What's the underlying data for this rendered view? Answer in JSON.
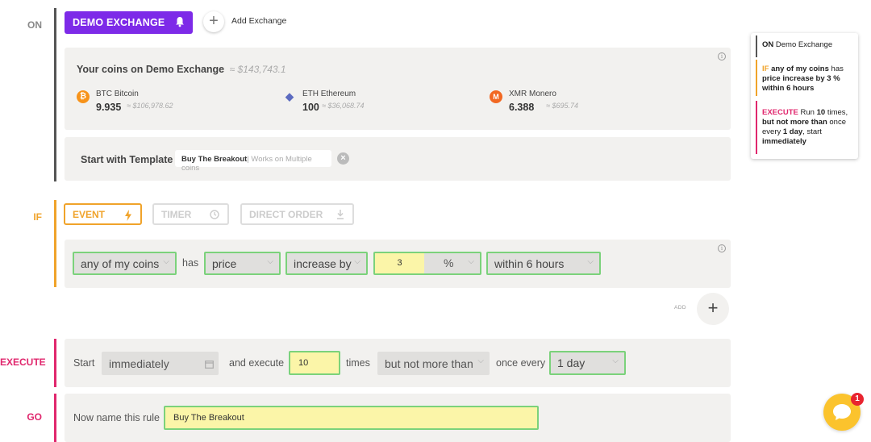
{
  "colors": {
    "on": "#555555",
    "if": "#f0a32a",
    "execute": "#e0276d",
    "go": "#e0276d",
    "exchange_button": "#7d2ae8",
    "valid_border": "#7bd27b",
    "input_highlight": "#fbf5a8",
    "chat_bubble": "#fbc32d",
    "notification": "#e8242f"
  },
  "sections": {
    "on_label": "ON",
    "if_label": "IF",
    "execute_label": "EXECUTE",
    "go_label": "GO"
  },
  "on": {
    "exchange_button": "DEMO EXCHANGE",
    "exchange_button_icon": "bell-icon",
    "add_exchange": "Add Exchange",
    "coins_title": "Your coins on Demo Exchange",
    "coins_total": "≈ $143,743.1",
    "coins": [
      {
        "icon": "bitcoin-icon",
        "symbol_glyph": "₿",
        "color": "#f7931a",
        "name": "BTC Bitcoin",
        "amount": "9.935",
        "value": "≈ $106,978.62"
      },
      {
        "icon": "ethereum-icon",
        "symbol_glyph": "◆",
        "color": "#5c6bc0",
        "name": "ETH Ethereum",
        "amount": "100",
        "value": "≈ $36,068.74"
      },
      {
        "icon": "monero-icon",
        "symbol_glyph": "M",
        "color": "#f26822",
        "name": "XMR Monero",
        "amount": "6.388",
        "value": "≈ $695.74"
      }
    ],
    "template_label": "Start with Template",
    "template_name": "Buy The Breakout",
    "template_note": "| Works on Multiple coins"
  },
  "if": {
    "tabs": [
      {
        "label": "EVENT",
        "icon": "bolt-icon",
        "active": true
      },
      {
        "label": "TIMER",
        "icon": "clock-icon",
        "active": false
      },
      {
        "label": "DIRECT ORDER",
        "icon": "download-icon",
        "active": false
      }
    ],
    "condition": {
      "coins": "any of my coins",
      "has": "has",
      "metric": "price",
      "direction": "increase by",
      "amount": "3",
      "unit": "%",
      "window": "within 6 hours"
    },
    "add_label": "ADD"
  },
  "execute": {
    "start_label": "Start",
    "start_value": "immediately",
    "and_execute": "and execute",
    "times_value": "10",
    "times_label": "times",
    "limit": "but not more than",
    "once_every": "once every",
    "period": "1 day"
  },
  "go": {
    "name_label": "Now name this rule",
    "name_value": "Buy The Breakout"
  },
  "summary": {
    "on_kw": "ON",
    "on_text": "Demo Exchange",
    "if_kw": "IF",
    "if_b1": "any of my coins",
    "if_t1": "has",
    "if_b2": "price increase by 3 %",
    "if_b3": "within 6 hours",
    "exec_kw": "EXECUTE",
    "exec_t1": "Run",
    "exec_b1": "10",
    "exec_t2": "times,",
    "exec_b2": "but not more than",
    "exec_t3": "once every",
    "exec_b3": "1 day",
    "exec_t4": ", start",
    "exec_b4": "immediately"
  },
  "chat": {
    "badge_count": "1"
  }
}
